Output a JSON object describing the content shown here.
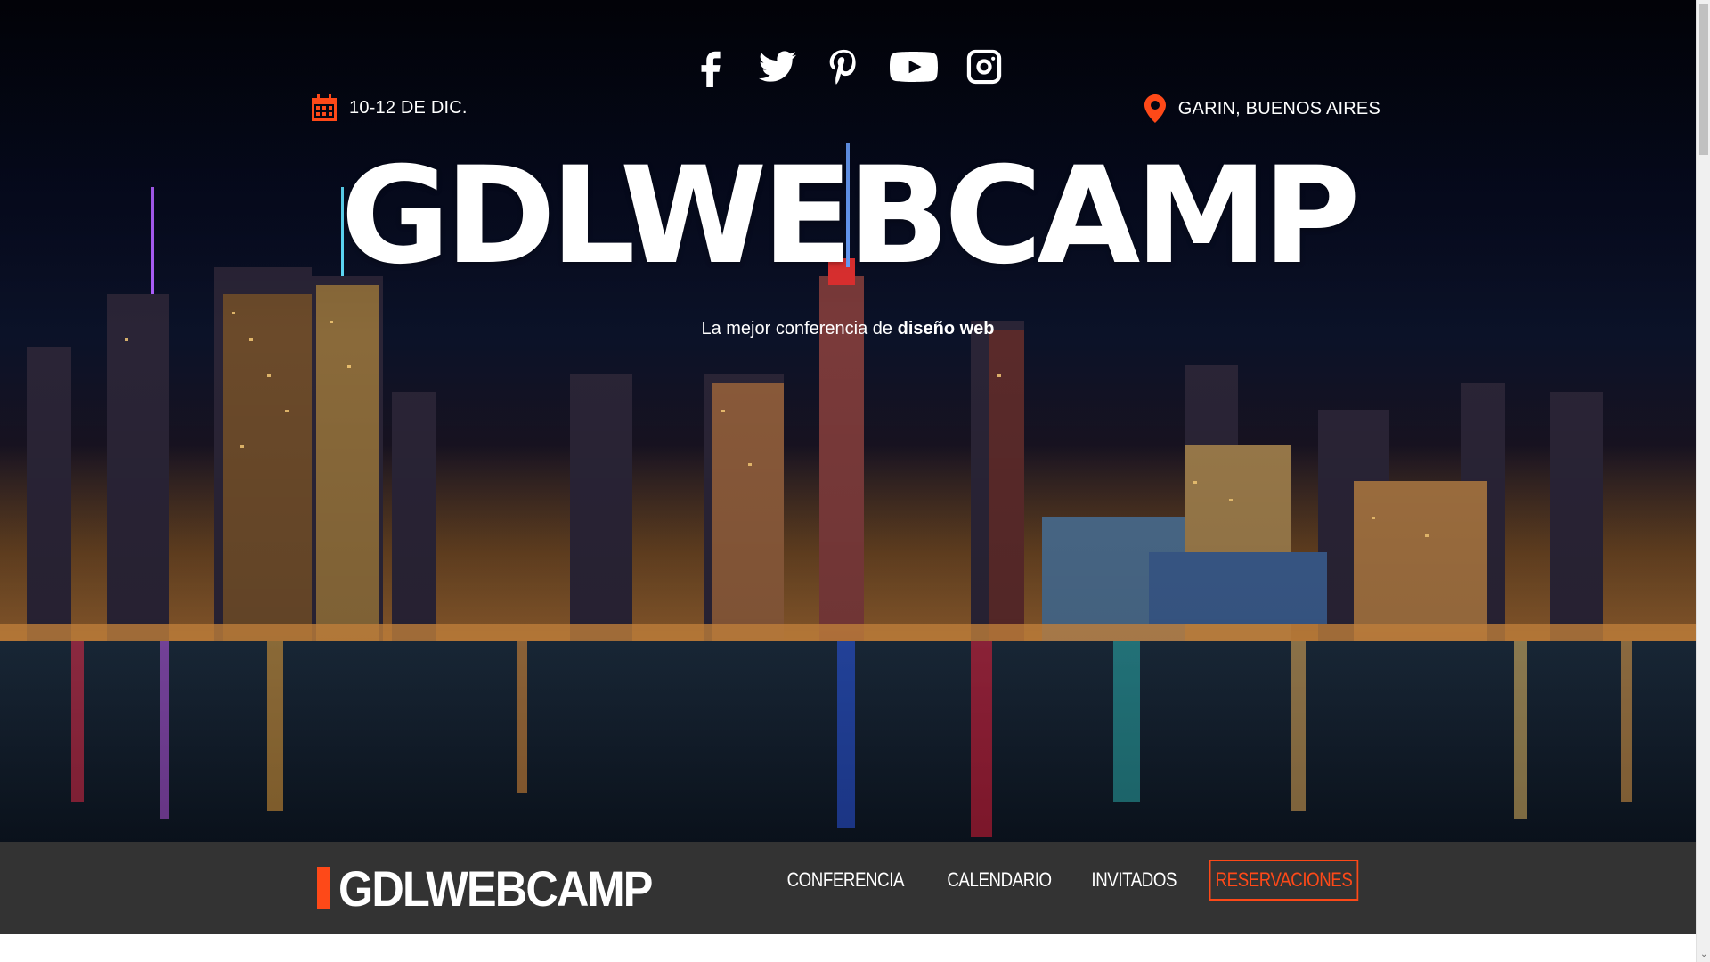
{
  "social": {
    "icons": [
      "facebook-icon",
      "twitter-icon",
      "pinterest-icon",
      "youtube-icon",
      "instagram-icon"
    ]
  },
  "event": {
    "date": "10-12 DE DIC.",
    "location": "GARIN, BUENOS AIRES"
  },
  "hero": {
    "title": "GDLWEBCAMP",
    "tagline_start": "La mejor conferencia de ",
    "tagline_strong": "diseño web"
  },
  "navbar": {
    "logo": "GDLWEBCAMP",
    "items": [
      {
        "label": "CONFERENCIA"
      },
      {
        "label": "CALENDARIO"
      },
      {
        "label": "INVITADOS"
      },
      {
        "label": "RESERVACIONES",
        "active": true
      }
    ]
  },
  "colors": {
    "accent": "#fe4918",
    "navbar_bg": "#333333",
    "text_light": "#ffffff"
  }
}
